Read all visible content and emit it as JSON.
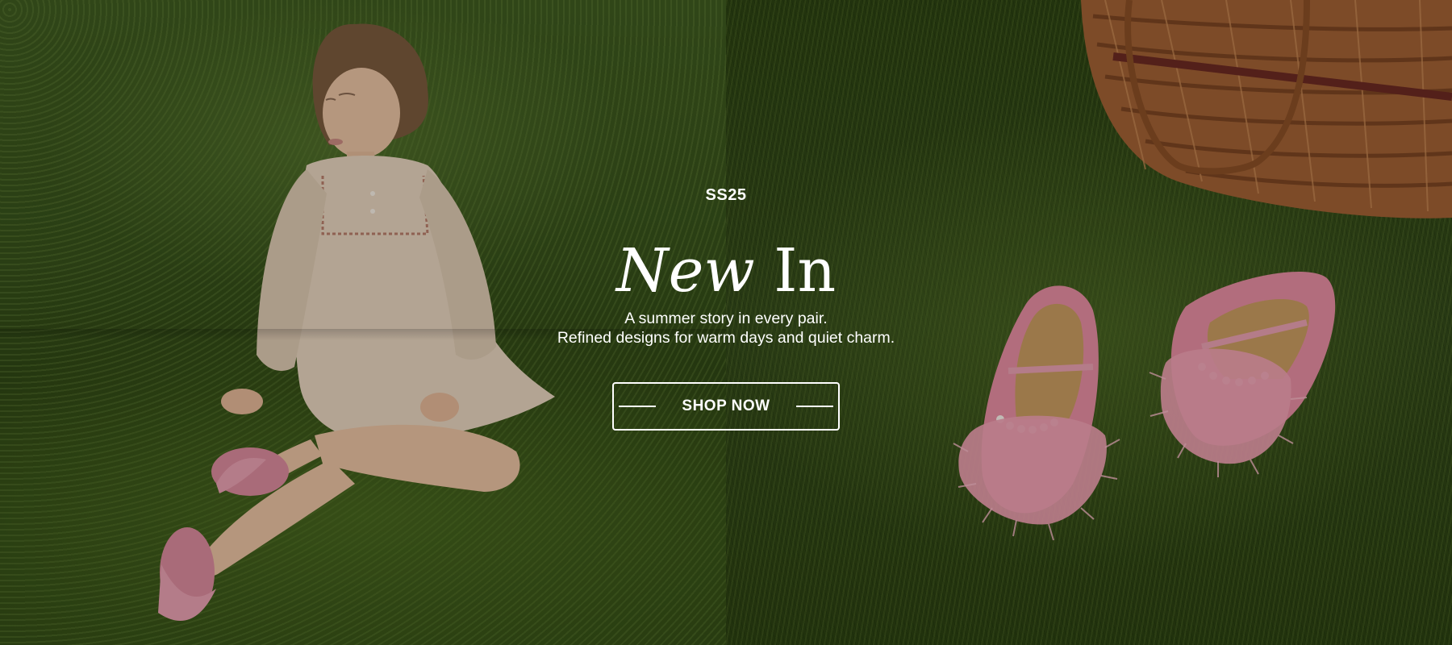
{
  "hero": {
    "eyebrow": "SS25",
    "headline_script": "New",
    "headline_rest": "In",
    "subtitle_line1": "A summer story in every pair.",
    "subtitle_line2": "Refined designs for warm days and quiet charm.",
    "cta_label": "SHOP NOW"
  },
  "images": {
    "left": "girl-in-white-dress-on-grass",
    "right": "pink-feather-ballet-flats-and-wicker-basket"
  },
  "colors": {
    "grass": "#34491a",
    "text": "#ffffff",
    "shoe_pink": "#e58ca0",
    "dress": "#e8d6c2",
    "basket": "#9c5a2c"
  }
}
